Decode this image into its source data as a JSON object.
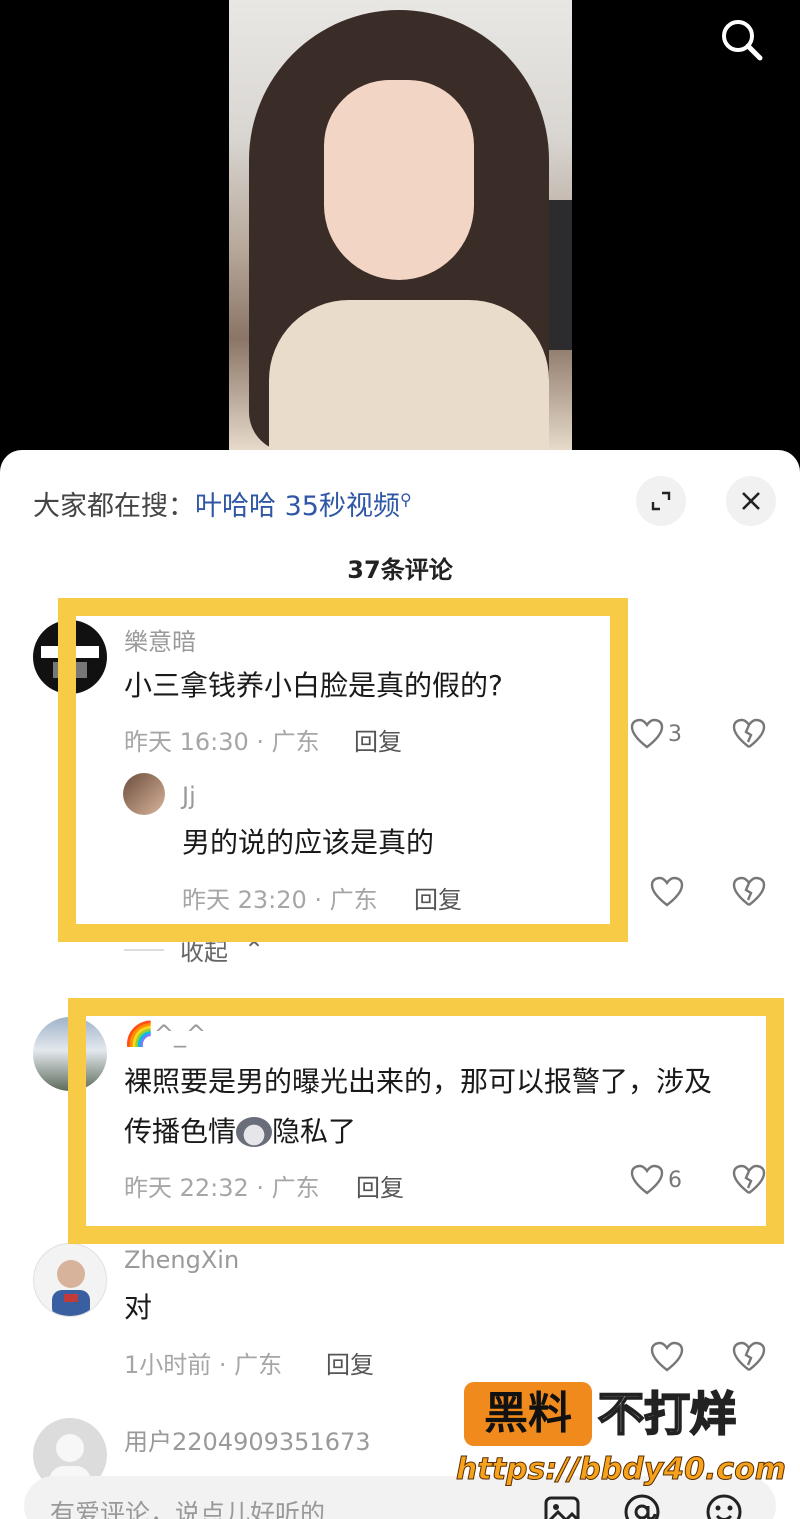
{
  "header": {
    "hot_search_prefix": "大家都在搜：",
    "hot_search_term": "叶哈哈 35秒视频"
  },
  "comments_count": "37条评论",
  "comments": [
    {
      "user": "樂意暗",
      "text": "小三拿钱养小白脸是真的假的?",
      "meta": "昨天 16:30 · 广东",
      "reply_label": "回复",
      "likes": "3",
      "replies": [
        {
          "user": "Jj",
          "text": "男的说的应该是真的",
          "meta": "昨天 23:20 · 广东",
          "reply_label": "回复"
        }
      ],
      "collapse_label": "收起"
    },
    {
      "user": "🌈^_^",
      "text_line1": "裸照要是男的曝光出来的，那可以报警了，涉及",
      "text_line2_a": "传播色情",
      "text_line2_b": "隐私了",
      "meta": "昨天 22:32 · 广东",
      "reply_label": "回复",
      "likes": "6"
    },
    {
      "user": "ZhengXin",
      "text": "对",
      "meta": "1小时前 · 广东",
      "reply_label": "回复"
    },
    {
      "user": "用户2204909351673"
    }
  ],
  "input": {
    "placeholder": "有爱评论，说点儿好听的"
  },
  "watermark": {
    "box": "黑料",
    "text": "不打烊",
    "url": "https://bbdy40.com"
  },
  "colors": {
    "highlight": "#f7cb45",
    "link": "#2f57a6",
    "watermark": "#f08a1c"
  }
}
